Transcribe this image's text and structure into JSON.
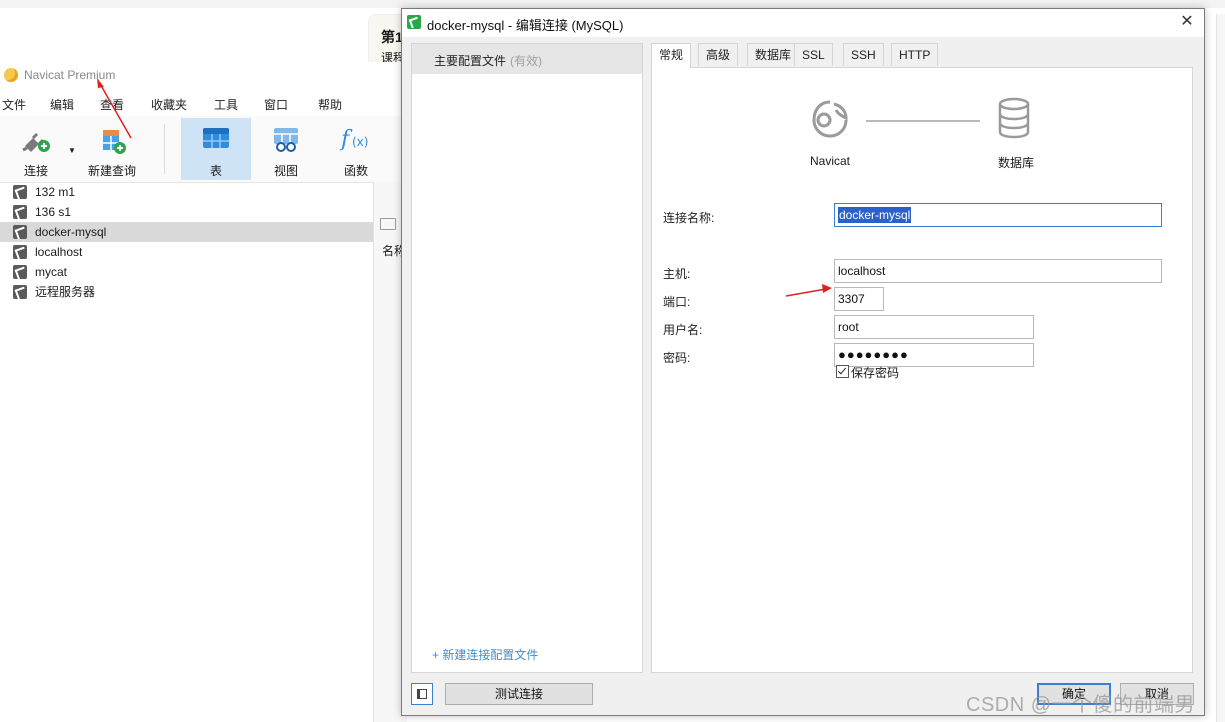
{
  "background": {
    "web_card": {
      "title": "第1",
      "subtitle": "课程"
    },
    "app_title": "Navicat Premium",
    "menu": [
      "文件",
      "编辑",
      "查看",
      "收藏夹",
      "工具",
      "窗口",
      "帮助"
    ],
    "toolbar": {
      "connect": "连接",
      "new_query": "新建查询",
      "table": "表",
      "view": "视图",
      "function": "函数"
    },
    "connections": [
      "132 m1",
      "136 s1",
      "docker-mysql",
      "localhost",
      "mycat",
      "远程服务器"
    ],
    "selected_connection": "docker-mysql",
    "right_pane_label": "名称"
  },
  "dialog": {
    "title": "docker-mysql - 编辑连接 (MySQL)",
    "close_symbol": "✕",
    "profile": {
      "name": "主要配置文件",
      "status": "(有效)"
    },
    "new_profile": "+ 新建连接配置文件",
    "tabs": [
      "常规",
      "高级",
      "数据库",
      "SSL",
      "SSH",
      "HTTP"
    ],
    "active_tab": "常规",
    "diagram": {
      "left": "Navicat",
      "right": "数据库"
    },
    "fields": {
      "connection_name": {
        "label": "连接名称:",
        "value": "docker-mysql"
      },
      "host": {
        "label": "主机:",
        "value": "localhost"
      },
      "port": {
        "label": "端口:",
        "value": "3307"
      },
      "username": {
        "label": "用户名:",
        "value": "root"
      },
      "password": {
        "label": "密码:",
        "value": "●●●●●●●●"
      }
    },
    "save_password": {
      "label": "保存密码",
      "checked": true
    },
    "buttons": {
      "test": "测试连接",
      "ok": "确定",
      "cancel": "取消"
    }
  },
  "watermark": "CSDN @一个傻的前端男",
  "colors": {
    "accent": "#3b7fd2",
    "annotation_arrow": "#e02020",
    "selection": "#2a62c9"
  }
}
